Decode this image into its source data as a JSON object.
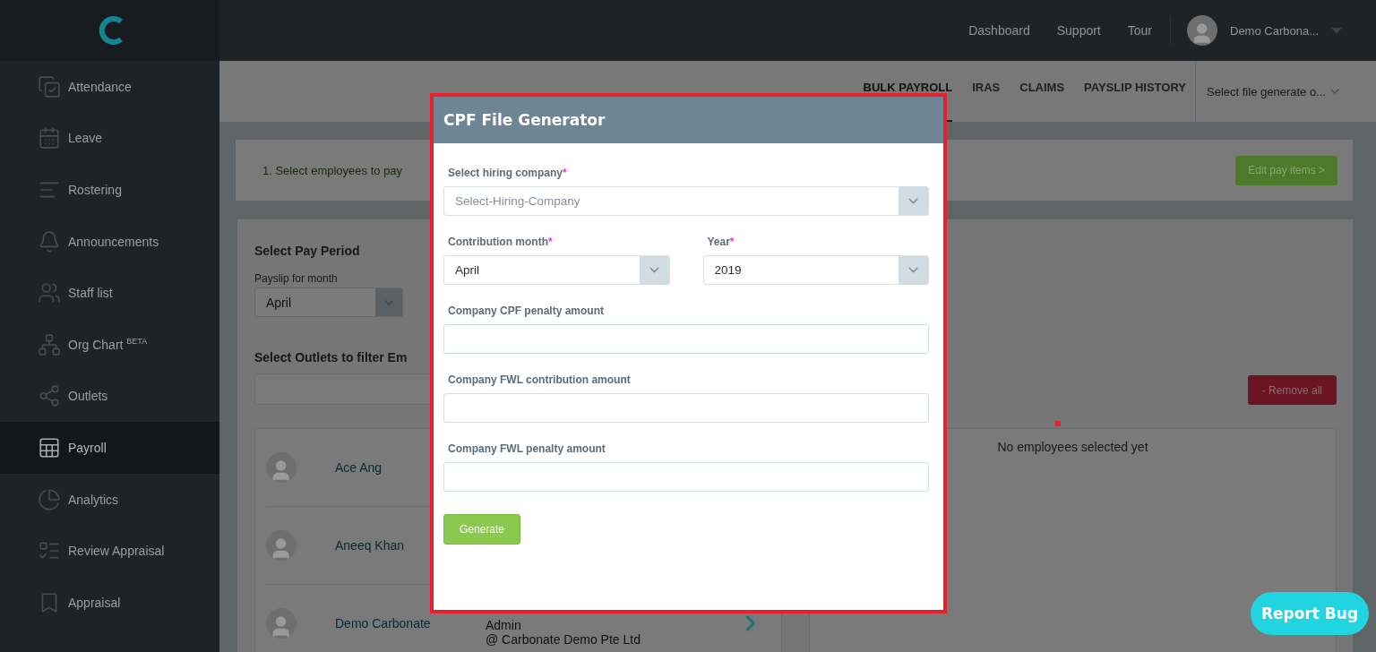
{
  "top_nav": {
    "links": [
      "Dashboard",
      "Support",
      "Tour"
    ],
    "user": "Demo Carbona..."
  },
  "sidebar": {
    "items": [
      {
        "label": "Attendance",
        "selected": false
      },
      {
        "label": "Leave",
        "selected": false
      },
      {
        "label": "Rostering",
        "selected": false
      },
      {
        "label": "Announcements",
        "selected": false
      },
      {
        "label": "Staff list",
        "selected": false
      },
      {
        "label": "Org Chart $^{BETA}$",
        "selected": false
      },
      {
        "label": "Outlets",
        "selected": false
      },
      {
        "label": "Payroll",
        "selected": true
      },
      {
        "label": "Analytics",
        "selected": false
      },
      {
        "label": "Review Appraisal",
        "selected": false
      },
      {
        "label": "Appraisal",
        "selected": false
      }
    ]
  },
  "tabs": [
    {
      "label": "BULK PAYROLL",
      "selected": true
    },
    {
      "label": "IRAS",
      "selected": false
    },
    {
      "label": "CLAIMS",
      "selected": false
    },
    {
      "label": "PAYSLIP HISTORY",
      "selected": false
    }
  ],
  "file_select": {
    "placeholder": "Select file generate o..."
  },
  "step": {
    "label": "1. Select employees to pay"
  },
  "edit_button": "Edit pay items >",
  "pay_period": {
    "title": "Select Pay Period",
    "label": "Payslip for month",
    "value": "April"
  },
  "outlets": {
    "title": "Select Outlets to filter Em"
  },
  "remove_button": "- Remove all",
  "employees": [
    {
      "name": "Ace Ang"
    },
    {
      "name": "Aneeq Khan"
    },
    {
      "name": "Demo Carbonate",
      "role": "Admin",
      "company": "@ Carbonate Demo Pte Ltd"
    }
  ],
  "selected_empty": "No employees selected yet",
  "modal": {
    "title": "CPF File Generator",
    "rows": [
      [
        {
          "kind": "select",
          "label": "Select hiring company",
          "mark": "*",
          "placeholder": "Select-Hiring-Company"
        }
      ],
      [
        {
          "kind": "select",
          "label": "Contribution month",
          "mark": "*",
          "value": "April"
        },
        {
          "kind": "select",
          "label": "Year",
          "mark": "*",
          "value": "2019"
        }
      ],
      [
        {
          "kind": "text",
          "label": "Company CPF penalty amount"
        }
      ],
      [
        {
          "kind": "text",
          "label": "Company FWL contribution amount"
        }
      ],
      [
        {
          "kind": "text",
          "label": "Company FWL penalty amount"
        }
      ]
    ],
    "button": "Generate"
  },
  "report_button": "Report Bug"
}
